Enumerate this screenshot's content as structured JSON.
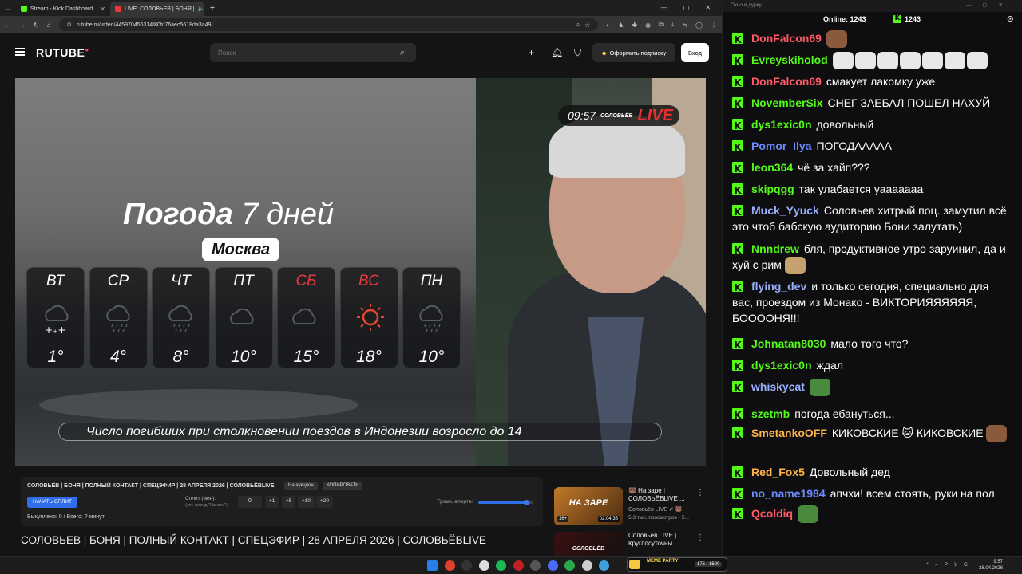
{
  "browser": {
    "tabs": [
      {
        "label": "Stream - Kick Dashboard",
        "active": false,
        "color": "#53fc18"
      },
      {
        "label": "LIVE: СОЛОВЬЁВ | БОНЯ |",
        "active": true,
        "color": "#e8393a"
      }
    ],
    "url": "rutube.ru/video/445970456314f80fc76aec5618da3a49/"
  },
  "rutube": {
    "logo": "RUTUBE",
    "search_placeholder": "Поиск",
    "subscribe_label": "Оформить подписку",
    "login_label": "Вход"
  },
  "video": {
    "live_time": "09:57",
    "live_brand": "СОЛОВЬЁВ",
    "live_word": "LIVE",
    "weather_title_bold": "Погода",
    "weather_title_rest": "7 дней",
    "city": "Москва",
    "days": [
      {
        "name": "ВТ",
        "temp": "1°",
        "weekend": false,
        "icon": "snow"
      },
      {
        "name": "СР",
        "temp": "4°",
        "weekend": false,
        "icon": "rain"
      },
      {
        "name": "ЧТ",
        "temp": "8°",
        "weekend": false,
        "icon": "rain"
      },
      {
        "name": "ПТ",
        "temp": "10°",
        "weekend": false,
        "icon": "cloud"
      },
      {
        "name": "СБ",
        "temp": "15°",
        "weekend": true,
        "icon": "cloud"
      },
      {
        "name": "ВС",
        "temp": "18°",
        "weekend": true,
        "icon": "sun"
      },
      {
        "name": "ПН",
        "temp": "10°",
        "weekend": false,
        "icon": "rain"
      }
    ],
    "ticker": "Число погибших при столкновении поездов в Индонезии возросло до 14"
  },
  "panel": {
    "title": "СОЛОВЬЁВ | БОНЯ | ПОЛНЫЙ КОНТАКТ | СПЕЦЭФИР | 28 АПРЕЛЯ 2026 | СОЛОВЬЁВLIVE",
    "chip_auction": "На аукцион",
    "chip_copy": "КОПИРОВАТЬ",
    "split_button": "НАЧАТЬ СПЛИТ",
    "split_label": "Сплит (мин):",
    "split_hint": "(уст. перед \"Начать\")",
    "split_value": "0",
    "steps": [
      "+1",
      "+5",
      "+10",
      "+20"
    ],
    "volume_label": "Громк. алерта:",
    "volume_level": 0.88,
    "stats": "Выкуплено: 0 / Всего: ? минут"
  },
  "main_title": "СОЛОВЬЕВ | БОНЯ | ПОЛНЫЙ КОНТАКТ | СПЕЦЭФИР | 28 АПРЕЛЯ 2026 | СОЛОВЬЁВLIVE",
  "recommendations": [
    {
      "title": "🐻 На заре | СОЛОВЬЁВLIVE ...",
      "channel": "Соловьёв LIVE ✔ 🐻",
      "meta": "5,3 тыс. просмотров • 5...",
      "thumb_text": "НА ЗАРЕ",
      "age": "16+",
      "duration": "02:04:36"
    },
    {
      "title": "Соловьёв LIVE | Круглосуточны...",
      "channel": "",
      "meta": "",
      "thumb_text": "СОЛОВЬЁВ",
      "age": "",
      "duration": ""
    }
  ],
  "chat": {
    "window_title": "Окно в дурку",
    "online_label": "Online:",
    "online_count": "1243",
    "kick_count": "1243",
    "messages": [
      {
        "user": "DonFalcon69",
        "color": "#ff5a66",
        "text": "",
        "emotes": 1
      },
      {
        "user": "Evreyskiholod",
        "color": "#53fc18",
        "text": "",
        "emotes": 7
      },
      {
        "user": "DonFalcon69",
        "color": "#ff5a66",
        "text": "смакует лакомку уже",
        "emotes": 0
      },
      {
        "user": "NovemberSix",
        "color": "#53fc18",
        "text": "СНЕГ ЗАЕБАЛ ПОШЕЛ НАХУЙ",
        "emotes": 0
      },
      {
        "user": "dys1exic0n",
        "color": "#53fc18",
        "text": "довольный",
        "emotes": 0
      },
      {
        "user": "Pomor_Ilya",
        "color": "#6c8cff",
        "text": "ПОГОДААААА",
        "emotes": 0
      },
      {
        "user": "leon364",
        "color": "#53fc18",
        "text": "чё за хайп???",
        "emotes": 0
      },
      {
        "user": "skipqgg",
        "color": "#53fc18",
        "text": "так улабается уааааааа",
        "emotes": 0
      },
      {
        "user": "Muck_Yyuck",
        "color": "#9ab0ff",
        "text": "Соловьев хитрый поц. замутил всё это чтоб бабскую аудиторию Бони залутать)",
        "emotes": 0
      },
      {
        "user": "Nnndrew",
        "color": "#53fc18",
        "text": "бля, продуктивное утро заруинил, да и хуй с рим",
        "emotes": 1
      },
      {
        "user": "flying_dev",
        "color": "#9ab0ff",
        "text": "и только сегодня, специально для вас, проездом из Монако - ВИКТОРИЯЯЯЯЯЯ, БООООНЯ!!!",
        "emotes": 0
      },
      {
        "user": "Johnatan8030",
        "color": "#53fc18",
        "text": "мало того что?",
        "emotes": 0
      },
      {
        "user": "dys1exic0n",
        "color": "#53fc18",
        "text": "ждал",
        "emotes": 0
      },
      {
        "user": "whiskycat",
        "color": "#9ab0ff",
        "text": "",
        "emotes": 1
      },
      {
        "user": "szetmb",
        "color": "#53fc18",
        "text": "погода ебануться...",
        "emotes": 0
      },
      {
        "user": "SmetankoOFF",
        "color": "#ffb347",
        "text": "КИКОВСКИЕ 🐱 КИКОВСКИЕ",
        "emotes": 1
      },
      {
        "user": "Red_Fox5",
        "color": "#ffb347",
        "text": "Довольный дед",
        "emotes": 0
      },
      {
        "user": "no_name1984",
        "color": "#6c8cff",
        "text": "апчхи! всем стоять, руки на пол",
        "emotes": 0
      },
      {
        "user": "Qcoldiq",
        "color": "#ff5a66",
        "text": "",
        "emotes": 1
      }
    ]
  },
  "taskbar": {
    "meme_label": "MEME PARTY",
    "meme_count": "175 / 1500",
    "lang": "РУС",
    "time": "9:57",
    "date": "28.04.2026"
  },
  "colors": {
    "kick_green": "#53fc18",
    "rutube_blue": "#2f6ee8",
    "live_red": "#e83030"
  }
}
